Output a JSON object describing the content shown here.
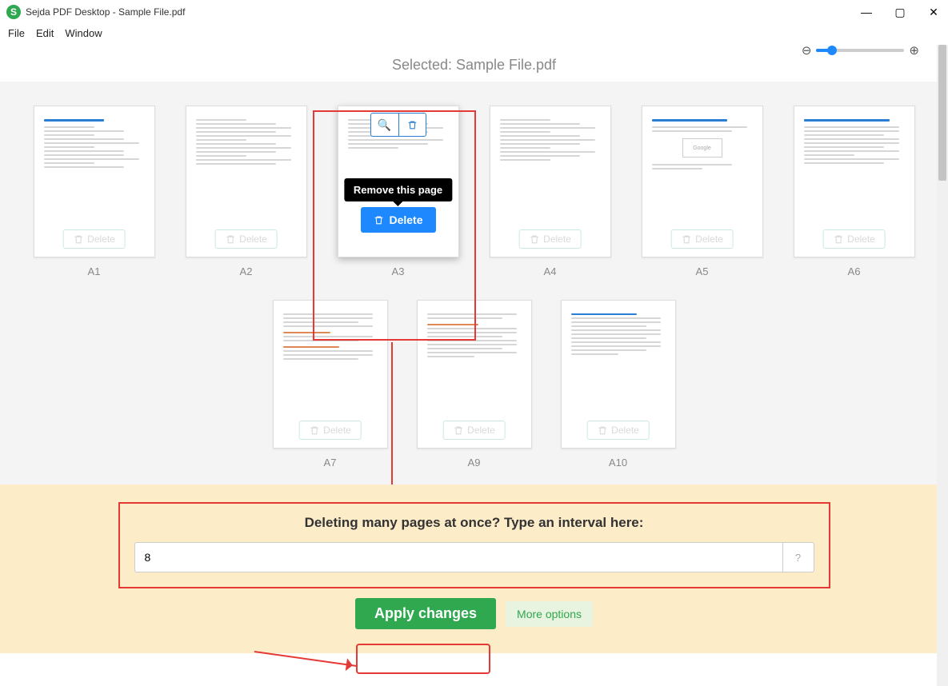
{
  "window": {
    "logo_letter": "S",
    "title": "Sejda PDF Desktop - Sample File.pdf"
  },
  "menu": {
    "file": "File",
    "edit": "Edit",
    "window": "Window"
  },
  "subheader": "Selected: Sample File.pdf",
  "delete_label": "Delete",
  "pages_row1": [
    {
      "label": "A1"
    },
    {
      "label": "A2"
    },
    {
      "label": "A3"
    },
    {
      "label": "A4"
    },
    {
      "label": "A5"
    },
    {
      "label": "A6"
    }
  ],
  "pages_row2": [
    {
      "label": "A7"
    },
    {
      "label": "A9"
    },
    {
      "label": "A10"
    }
  ],
  "a3": {
    "tooltip": "Remove this page",
    "delete_label": "Delete"
  },
  "footer": {
    "title": "Deleting many pages at once? Type an interval here:",
    "interval_value": "8",
    "apply": "Apply changes",
    "more": "More options"
  }
}
